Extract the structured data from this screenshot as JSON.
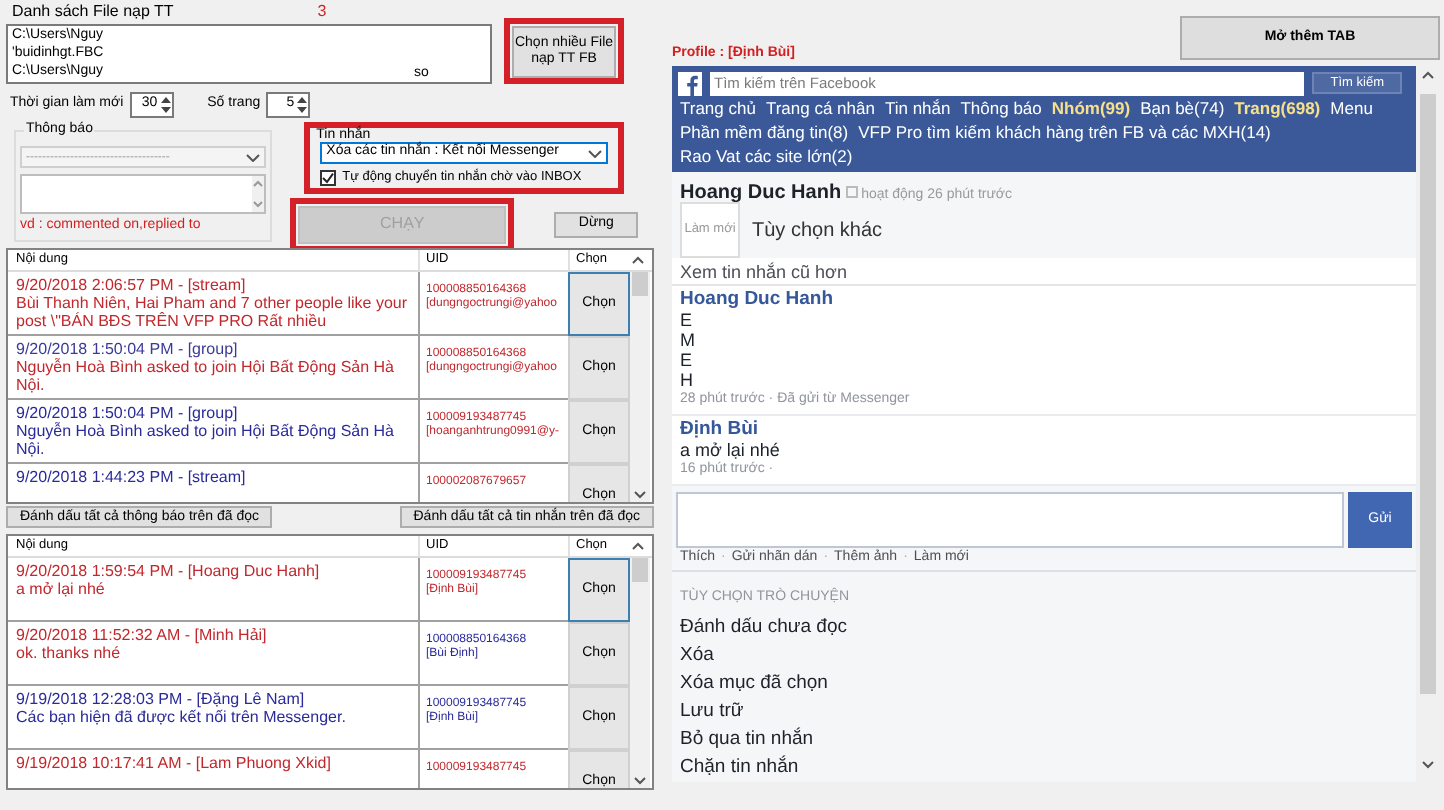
{
  "left": {
    "file_list": {
      "label": "Danh sách File nạp TT",
      "count": "3",
      "lines": [
        "C:\\Users\\Nguy",
        "'buidinhgt.FBC",
        "C:\\Users\\Nguy"
      ],
      "fragment": "so"
    },
    "choose_button": "Chọn nhiều File nạp TT FB",
    "refresh": {
      "label": "Thời gian làm mới",
      "value": "30"
    },
    "pages": {
      "label": "Số trang",
      "value": "5"
    },
    "notifications": {
      "title": "Thông báo",
      "combo_value": "------------------------------------",
      "hint": "vd : commented on,replied to"
    },
    "messages": {
      "title": "Tin nhắn",
      "combo_value": "Xóa các tin nhắn : Kết nối Messenger",
      "checkbox": {
        "label": "Tự động chuyển tin nhắn chờ vào INBOX",
        "checked": true
      }
    },
    "run_button": {
      "label": "CHẠY",
      "disabled": true
    },
    "stop_button": "Dừng",
    "notification_grid": {
      "columns": [
        "Nội dung",
        "UID",
        "Chọn"
      ],
      "rows": [
        {
          "content": [
            {
              "text": "9/20/2018 2:06:57 PM - [stream]",
              "color": "#c0282d"
            },
            {
              "text": "Bùi Thanh Niên, Hai Pham and 7 other people like your post \\\"BÁN BĐS TRÊN VFP PRO Rất nhiều",
              "color": "#c0282d"
            }
          ],
          "uid": [
            {
              "text": "100008850164368",
              "color": "#c0282d"
            },
            {
              "text": "[dungngoctrungi@yahoo",
              "color": "#c0282d"
            }
          ],
          "button": "Chọn",
          "selected": true
        },
        {
          "content": [
            {
              "text": "9/20/2018 1:50:04 PM - [group]",
              "color": "#3a3a9a"
            },
            {
              "text": "Nguyễn Hoà Bình asked to join Hội Bất Động Sản Hà Nội.",
              "color": "#c0282d"
            }
          ],
          "uid": [
            {
              "text": "100008850164368",
              "color": "#c0282d"
            },
            {
              "text": "[dungngoctrungi@yahoo",
              "color": "#c0282d"
            }
          ],
          "button": "Chọn",
          "selected": false
        },
        {
          "content": [
            {
              "text": "9/20/2018 1:50:04 PM - [group]",
              "color": "#2a2a9a"
            },
            {
              "text": "Nguyễn Hoà Bình asked to join Hội Bất Động Sản Hà Nội.",
              "color": "#2a2a9a"
            }
          ],
          "uid": [
            {
              "text": "100009193487745",
              "color": "#c0282d"
            },
            {
              "text": "[hoanganhtrung0991@y-",
              "color": "#c0282d"
            }
          ],
          "button": "Chọn",
          "selected": false
        },
        {
          "content": [
            {
              "text": "9/20/2018 1:44:23 PM - [stream]",
              "color": "#2a2a9a"
            }
          ],
          "uid": [
            {
              "text": "100002087679657",
              "color": "#c0282d"
            }
          ],
          "button": "Chọn",
          "selected": false
        }
      ]
    },
    "mark_buttons": [
      "Đánh dấu tất cả thông báo trên đã đọc",
      "Đánh dấu tất cả tin nhắn trên đã đọc"
    ],
    "message_grid": {
      "columns": [
        "Nội dung",
        "UID",
        "Chọn"
      ],
      "rows": [
        {
          "content": [
            {
              "text": "9/20/2018 1:59:54 PM - [Hoang Duc Hanh]",
              "color": "#c0282d"
            },
            {
              "text": "a mở lại nhé",
              "color": "#c0282d"
            }
          ],
          "uid": [
            {
              "text": "100009193487745",
              "color": "#c0282d"
            },
            {
              "text": "[Định Bùi]",
              "color": "#c0282d"
            }
          ],
          "button": "Chọn",
          "selected": true
        },
        {
          "content": [
            {
              "text": "9/20/2018 11:52:32 AM - [Minh Hải]",
              "color": "#c0282d"
            },
            {
              "text": "ok. thanks nhé",
              "color": "#c0282d"
            }
          ],
          "uid": [
            {
              "text": "100008850164368",
              "color": "#2a2a9a"
            },
            {
              "text": "[Bùi Định]",
              "color": "#2a2a9a"
            }
          ],
          "button": "Chọn",
          "selected": false
        },
        {
          "content": [
            {
              "text": "9/19/2018 12:28:03 PM - [Đặng Lê Nam]",
              "color": "#2a2a9a"
            },
            {
              "text": "Các bạn hiện đã được kết nối trên Messenger.",
              "color": "#2a2a9a"
            }
          ],
          "uid": [
            {
              "text": "100009193487745",
              "color": "#2a2a9a"
            },
            {
              "text": "[Định Bùi]",
              "color": "#2a2a9a"
            }
          ],
          "button": "Chọn",
          "selected": false
        },
        {
          "content": [
            {
              "text": "9/19/2018 10:17:41 AM - [Lam Phuong Xkid]",
              "color": "#c0282d"
            }
          ],
          "uid": [
            {
              "text": "100009193487745",
              "color": "#c0282d"
            }
          ],
          "button": "Chọn",
          "selected": false
        }
      ]
    }
  },
  "right": {
    "open_tab_button": "Mở thêm TAB",
    "profile": "Profile : [Định Bùi]",
    "facebook": {
      "search_placeholder": "Tìm kiếm trên Facebook",
      "search_button": "Tìm kiếm",
      "nav_rows": [
        [
          {
            "text": "Trang chủ",
            "highlighted": false
          },
          {
            "text": "Trang cá nhân",
            "highlighted": false
          },
          {
            "text": "Tin nhắn",
            "highlighted": false
          },
          {
            "text": "Thông báo",
            "highlighted": false
          },
          {
            "text": "Nhóm(99)",
            "highlighted": true
          },
          {
            "text": "Bạn bè(74)",
            "highlighted": false
          },
          {
            "text": "Trang(698)",
            "highlighted": true
          },
          {
            "text": "Menu",
            "highlighted": false
          }
        ],
        [
          {
            "text": "Phần mềm đăng tin(8)",
            "highlighted": false
          },
          {
            "text": "VFP Pro tìm kiếm khách hàng trên FB và các MXH(14)",
            "highlighted": false
          }
        ],
        [
          {
            "text": "Rao Vat các site lớn(2)",
            "highlighted": false
          }
        ]
      ]
    },
    "contact": {
      "name": "Hoang Duc Hanh",
      "status": "hoạt động 26 phút trước"
    },
    "refresh_button": "Làm mới",
    "more_options": "Tùy chọn khác",
    "older_link": "Xem tin nhắn cũ hơn",
    "conversation": [
      {
        "sender": "Hoang Duc Hanh",
        "lines": [
          "E",
          "M",
          "E",
          "H"
        ],
        "meta": "28 phút trước · Đã gửi từ Messenger"
      },
      {
        "sender": "Định Bùi",
        "lines": [
          "a mở lại nhé"
        ],
        "meta": "16 phút trước ·"
      }
    ],
    "send_button": "Gửi",
    "actions": [
      {
        "text": "Thích",
        "kind": "link"
      },
      {
        "text": "·",
        "kind": "separator"
      },
      {
        "text": "Gửi nhãn dán",
        "kind": "link"
      },
      {
        "text": "·",
        "kind": "separator"
      },
      {
        "text": "Thêm ảnh",
        "kind": "link"
      },
      {
        "text": "·",
        "kind": "separator"
      },
      {
        "text": "Làm mới",
        "kind": "link"
      }
    ],
    "options_title": "TÙY CHỌN TRÒ CHUYỆN",
    "options": [
      "Đánh dấu chưa đọc",
      "Xóa",
      "Xóa mục đã chọn",
      "Lưu trữ",
      "Bỏ qua tin nhắn",
      "Chặn tin nhắn"
    ]
  }
}
